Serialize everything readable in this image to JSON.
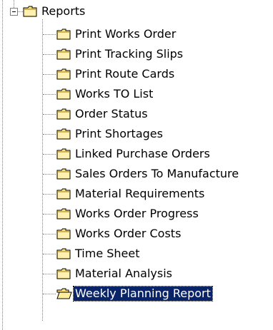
{
  "tree": {
    "root": {
      "label": "Reports",
      "expanded": true,
      "icon": "folder-icon"
    },
    "children": [
      {
        "label": "Print Works Order",
        "icon": "folder-icon",
        "selected": false
      },
      {
        "label": "Print Tracking Slips",
        "icon": "folder-icon",
        "selected": false
      },
      {
        "label": "Print Route Cards",
        "icon": "folder-icon",
        "selected": false
      },
      {
        "label": "Works TO List",
        "icon": "folder-icon",
        "selected": false
      },
      {
        "label": "Order Status",
        "icon": "folder-icon",
        "selected": false
      },
      {
        "label": "Print Shortages",
        "icon": "folder-icon",
        "selected": false
      },
      {
        "label": "Linked Purchase Orders",
        "icon": "folder-icon",
        "selected": false
      },
      {
        "label": "Sales Orders To Manufacture",
        "icon": "folder-icon",
        "selected": false
      },
      {
        "label": "Material Requirements",
        "icon": "folder-icon",
        "selected": false
      },
      {
        "label": "Works Order Progress",
        "icon": "folder-icon",
        "selected": false
      },
      {
        "label": "Works Order Costs",
        "icon": "folder-icon",
        "selected": false
      },
      {
        "label": "Time Sheet",
        "icon": "folder-icon",
        "selected": false
      },
      {
        "label": "Material Analysis",
        "icon": "folder-icon",
        "selected": false
      },
      {
        "label": "Weekly Planning Report",
        "icon": "folder-open-icon",
        "selected": true
      }
    ]
  },
  "colors": {
    "selection_bg": "#0a246a",
    "selection_text": "#ffffff",
    "folder_fill": "#ffe37a",
    "folder_outline": "#000000",
    "tree_lines": "#808080"
  }
}
